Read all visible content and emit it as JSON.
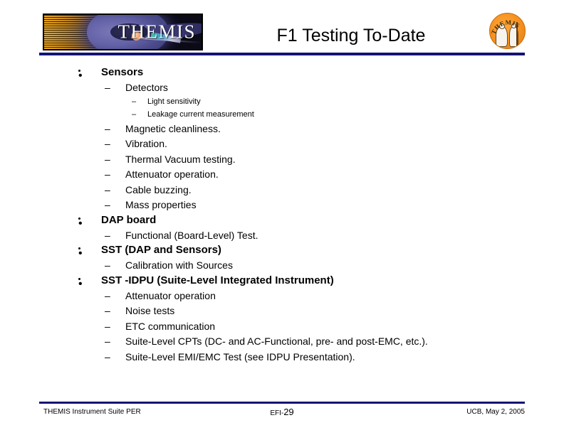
{
  "header": {
    "title": "F1 Testing To-Date",
    "logo_wordmark": "THEMIS",
    "patch_text": "THEMIS",
    "rule_color": "#131374"
  },
  "content": {
    "bullets": [
      {
        "level": 1,
        "marker": "•",
        "text": "Sensors"
      },
      {
        "level": 2,
        "marker": "–",
        "text": "Detectors"
      },
      {
        "level": 3,
        "marker": "–",
        "text": "Light sensitivity"
      },
      {
        "level": 3,
        "marker": "–",
        "text": "Leakage current measurement"
      },
      {
        "level": 2,
        "marker": "–",
        "text": "Magnetic cleanliness."
      },
      {
        "level": 2,
        "marker": "–",
        "text": "Vibration."
      },
      {
        "level": 2,
        "marker": "–",
        "text": "Thermal Vacuum testing."
      },
      {
        "level": 2,
        "marker": "–",
        "text": "Attenuator operation."
      },
      {
        "level": 2,
        "marker": "–",
        "text": "Cable buzzing."
      },
      {
        "level": 2,
        "marker": "–",
        "text": "Mass properties"
      },
      {
        "level": 1,
        "marker": "•",
        "text": "DAP board"
      },
      {
        "level": 2,
        "marker": "–",
        "text": "Functional (Board-Level) Test."
      },
      {
        "level": 1,
        "marker": "•",
        "text": "SST (DAP and Sensors)"
      },
      {
        "level": 2,
        "marker": "–",
        "text": "Calibration with Sources"
      },
      {
        "level": 1,
        "marker": "•",
        "text": "SST -IDPU (Suite-Level Integrated Instrument)"
      },
      {
        "level": 2,
        "marker": "–",
        "text": "Attenuator operation"
      },
      {
        "level": 2,
        "marker": "–",
        "text": "Noise tests"
      },
      {
        "level": 2,
        "marker": "–",
        "text": "ETC communication"
      },
      {
        "level": 2,
        "marker": "–",
        "text": "Suite-Level CPTs (DC- and AC-Functional, pre- and post-EMC, etc.)."
      },
      {
        "level": 2,
        "marker": "–",
        "text": "Suite-Level EMI/EMC Test (see IDPU Presentation)."
      }
    ]
  },
  "footer": {
    "left": "THEMIS Instrument Suite PER",
    "center_prefix": "EFI-",
    "page_number": "29",
    "right": "UCB, May 2, 2005"
  }
}
